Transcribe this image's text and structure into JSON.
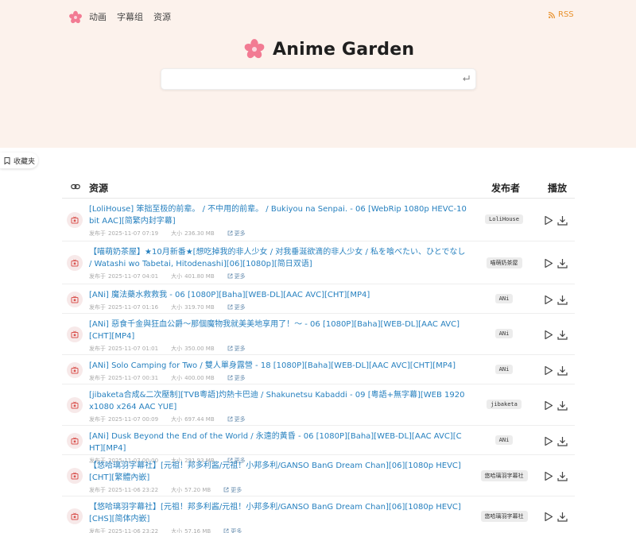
{
  "nav": {
    "links": [
      "动画",
      "字幕组",
      "资源"
    ],
    "rss": "RSS"
  },
  "brand": {
    "title": "Anime Garden"
  },
  "search": {
    "value": "",
    "placeholder": ""
  },
  "favorites": {
    "label": "收藏夹"
  },
  "table": {
    "headers": {
      "resource": "资源",
      "publisher": "发布者",
      "play": "播放"
    },
    "date_label": "发布于",
    "size_label": "大小",
    "more_label": "更多",
    "rows": [
      {
        "title": "[LoliHouse] 笨拙至极的前辈。 / 不中用的前辈。 / Bukiyou na Senpai. - 06 [WebRip 1080p HEVC-10bit AAC][简繁内封字幕]",
        "date": "2025-11-07 07:19",
        "size": "236.30 MB",
        "publisher": "LoliHouse"
      },
      {
        "title": "【喵萌奶茶屋】★10月新番★[想吃掉我的非人少女 / 对我垂涎欲滴的非人少女 / 私を喰べたい、ひとでなし / Watashi wo Tabetai, Hitodenashi][06][1080p][简日双语]",
        "date": "2025-11-07 04:01",
        "size": "401.80 MB",
        "publisher": "喵萌奶茶屋"
      },
      {
        "title": "[ANi] 魔法藥水救救我 - 06 [1080P][Baha][WEB-DL][AAC AVC][CHT][MP4]",
        "date": "2025-11-07 01:16",
        "size": "319.70 MB",
        "publisher": "ANi"
      },
      {
        "title": "[ANi] 惡食千金與狂血公爵～那個魔物我就美美地享用了！～ - 06 [1080P][Baha][WEB-DL][AAC AVC][CHT][MP4]",
        "date": "2025-11-07 01:01",
        "size": "350.00 MB",
        "publisher": "ANi"
      },
      {
        "title": "[ANi] Solo Camping for Two / 雙人單身露營 - 18 [1080P][Baha][WEB-DL][AAC AVC][CHT][MP4]",
        "date": "2025-11-07 00:31",
        "size": "400.00 MB",
        "publisher": "ANi"
      },
      {
        "title": "[jibaketa合成&二次壓制][TVB粵語]灼熱卡巴迪 / Shakunetsu Kabaddi - 09 [粵語+無字幕][WEB 1920x1080 x264 AAC YUE]",
        "date": "2025-11-07 00:09",
        "size": "697.44 MB",
        "publisher": "jibaketa"
      },
      {
        "title": "[ANi] Dusk Beyond the End of the World / 永遠的黃昏 - 06 [1080P][Baha][WEB-DL][AAC AVC][CHT][MP4]",
        "date": "2025-11-07 00:00",
        "size": "291.93 MB",
        "publisher": "ANi"
      },
      {
        "title": "【悠哈璃羽字幕社】[元祖！邦多利酱/元祖！小邦多利/GANSO BanG Dream Chan][06][1080p HEVC][CHT][繁體內嵌]",
        "date": "2025-11-06 23:22",
        "size": "57.20 MB",
        "publisher": "悠哈璃羽字幕社"
      },
      {
        "title": "【悠哈璃羽字幕社】[元祖！邦多利酱/元祖！小邦多利/GANSO BanG Dream Chan][06][1080p HEVC][CHS][简体内嵌]",
        "date": "2025-11-06 23:22",
        "size": "57.16 MB",
        "publisher": "悠哈璃羽字幕社"
      }
    ]
  }
}
